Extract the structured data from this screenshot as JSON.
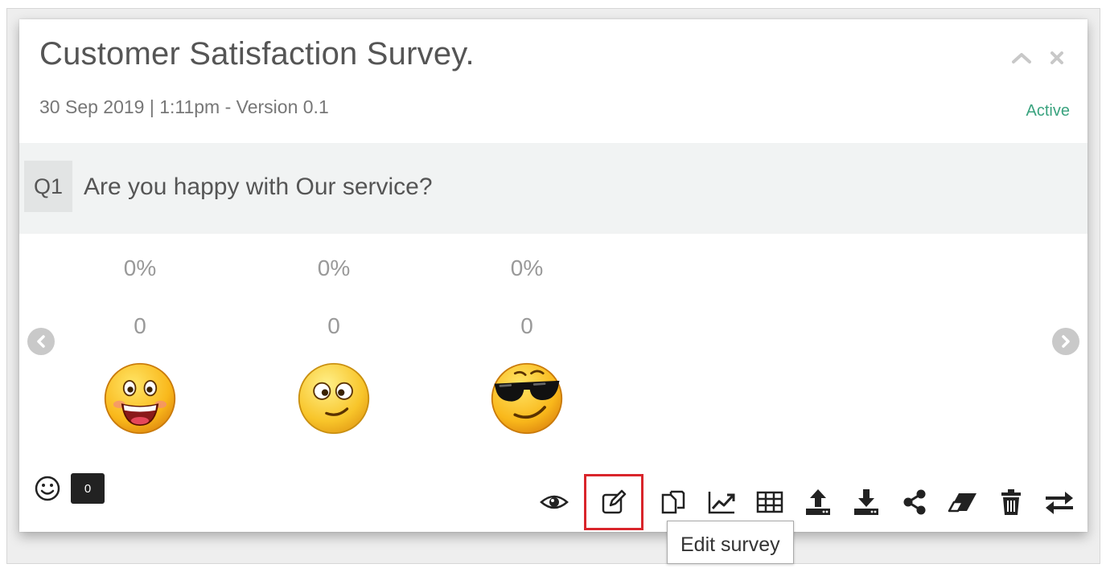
{
  "survey": {
    "title": "Customer Satisfaction Survey.",
    "meta": "30 Sep 2019 | 1:11pm - Version 0.1",
    "status": "Active"
  },
  "question": {
    "number": "Q1",
    "text": "Are you happy with Our service?"
  },
  "options": [
    {
      "percent": "0%",
      "count": "0",
      "icon": "grinning-face-icon"
    },
    {
      "percent": "0%",
      "count": "0",
      "icon": "dazed-smiling-face-icon"
    },
    {
      "percent": "0%",
      "count": "0",
      "icon": "sunglasses-face-icon"
    }
  ],
  "responses": {
    "count": "0",
    "icon": "smiley-outline-icon"
  },
  "toolbar": [
    "eye-icon",
    "edit-icon",
    "copy-icon",
    "line-chart-icon",
    "table-icon",
    "upload-icon",
    "download-icon",
    "share-icon",
    "eraser-icon",
    "trash-icon",
    "transfer-icon"
  ],
  "tooltip": "Edit survey",
  "colors": {
    "status": "#3aa37f",
    "highlight": "#d9252b",
    "band": "#f1f3f3"
  }
}
